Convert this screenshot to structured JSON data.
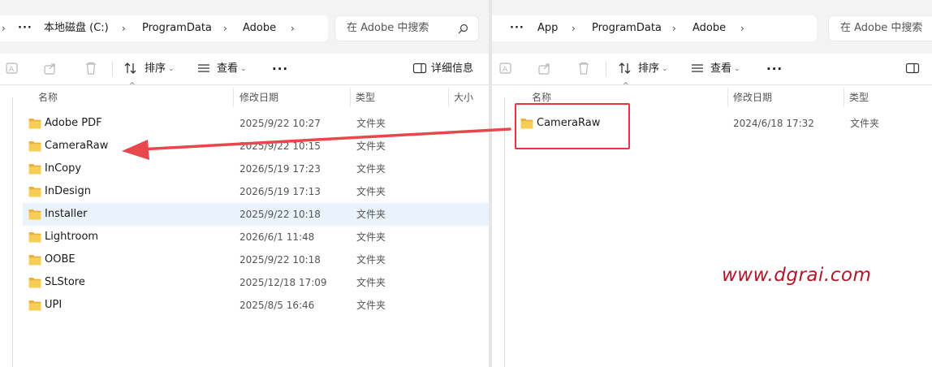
{
  "left": {
    "breadcrumb": [
      "本地磁盘 (C:)",
      "ProgramData",
      "Adobe"
    ],
    "search_placeholder": "在 Adobe 中搜索",
    "toolbar": {
      "sort_label": "排序",
      "view_label": "查看",
      "details_label": "详细信息"
    },
    "columns": [
      "名称",
      "修改日期",
      "类型",
      "大小"
    ],
    "rows": [
      {
        "name": "Adobe PDF",
        "date": "2025/9/22 10:27",
        "type": "文件夹"
      },
      {
        "name": "CameraRaw",
        "date": "2025/9/22 10:15",
        "type": "文件夹"
      },
      {
        "name": "InCopy",
        "date": "2026/5/19 17:23",
        "type": "文件夹"
      },
      {
        "name": "InDesign",
        "date": "2026/5/19 17:13",
        "type": "文件夹"
      },
      {
        "name": "Installer",
        "date": "2025/9/22 10:18",
        "type": "文件夹"
      },
      {
        "name": "Lightroom",
        "date": "2026/6/1 11:48",
        "type": "文件夹"
      },
      {
        "name": "OOBE",
        "date": "2025/9/22 10:18",
        "type": "文件夹"
      },
      {
        "name": "SLStore",
        "date": "2025/12/18 17:09",
        "type": "文件夹"
      },
      {
        "name": "UPI",
        "date": "2025/8/5 16:46",
        "type": "文件夹"
      }
    ]
  },
  "right": {
    "breadcrumb": [
      "App",
      "ProgramData",
      "Adobe"
    ],
    "search_placeholder": "在 Adobe 中搜索",
    "toolbar": {
      "sort_label": "排序",
      "view_label": "查看"
    },
    "columns": [
      "名称",
      "修改日期",
      "类型"
    ],
    "rows": [
      {
        "name": "CameraRaw",
        "date": "2024/6/18 17:32",
        "type": "文件夹"
      }
    ]
  },
  "watermark": "www.dgrai.com",
  "colors": {
    "arrow": "#e8474c",
    "highlight_box": "#e8363b",
    "folder": "#f2c34f",
    "watermark": "#b3172a",
    "selected_row": "#eaf3fb"
  }
}
